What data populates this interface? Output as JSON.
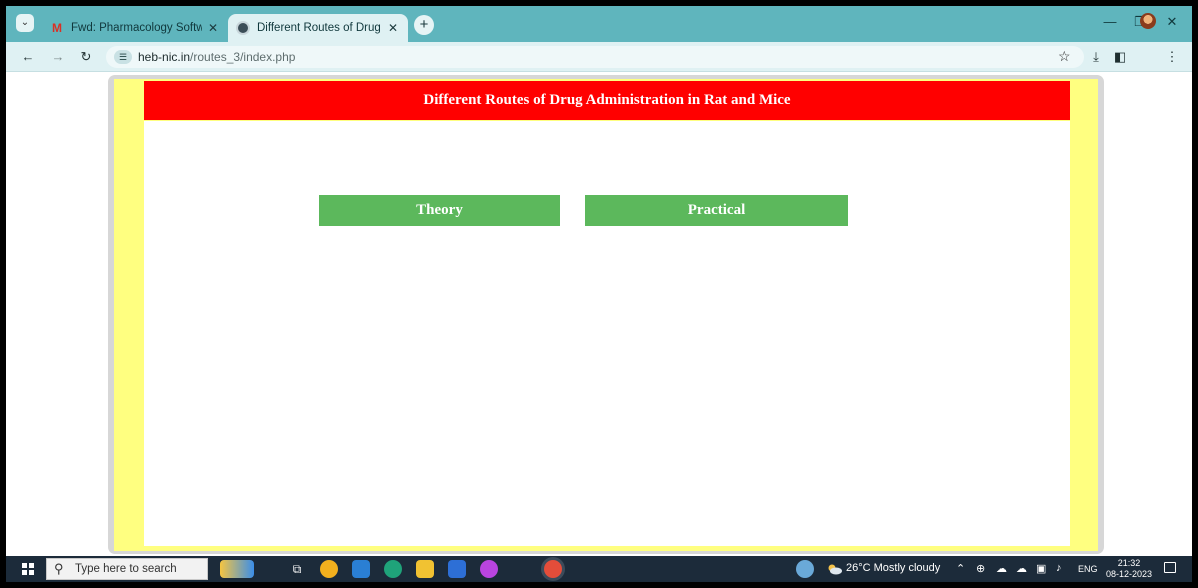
{
  "browser": {
    "tabs": [
      {
        "title": "Fwd: Pharmacology Software",
        "favicon": "gmail-icon",
        "active": false
      },
      {
        "title": "Different Routes of Drug Admi",
        "favicon": "globe-icon",
        "active": true
      }
    ],
    "new_tab_symbol": "+",
    "url_host": "heb-nic.in",
    "url_path": "/routes_3/index.php"
  },
  "page": {
    "header_title": "Different Routes of Drug Administration in Rat and Mice",
    "buttons": {
      "theory": "Theory",
      "practical": "Practical"
    }
  },
  "taskbar": {
    "search_placeholder": "Type here to search",
    "weather": "26°C  Mostly cloudy",
    "language": "ENG",
    "time": "21:32",
    "date": "08-12-2023"
  },
  "colors": {
    "header_bg": "#ff0000",
    "button_bg": "#5cb85c",
    "page_border": "#ffff80",
    "tab_strip": "#5fb5bd"
  }
}
